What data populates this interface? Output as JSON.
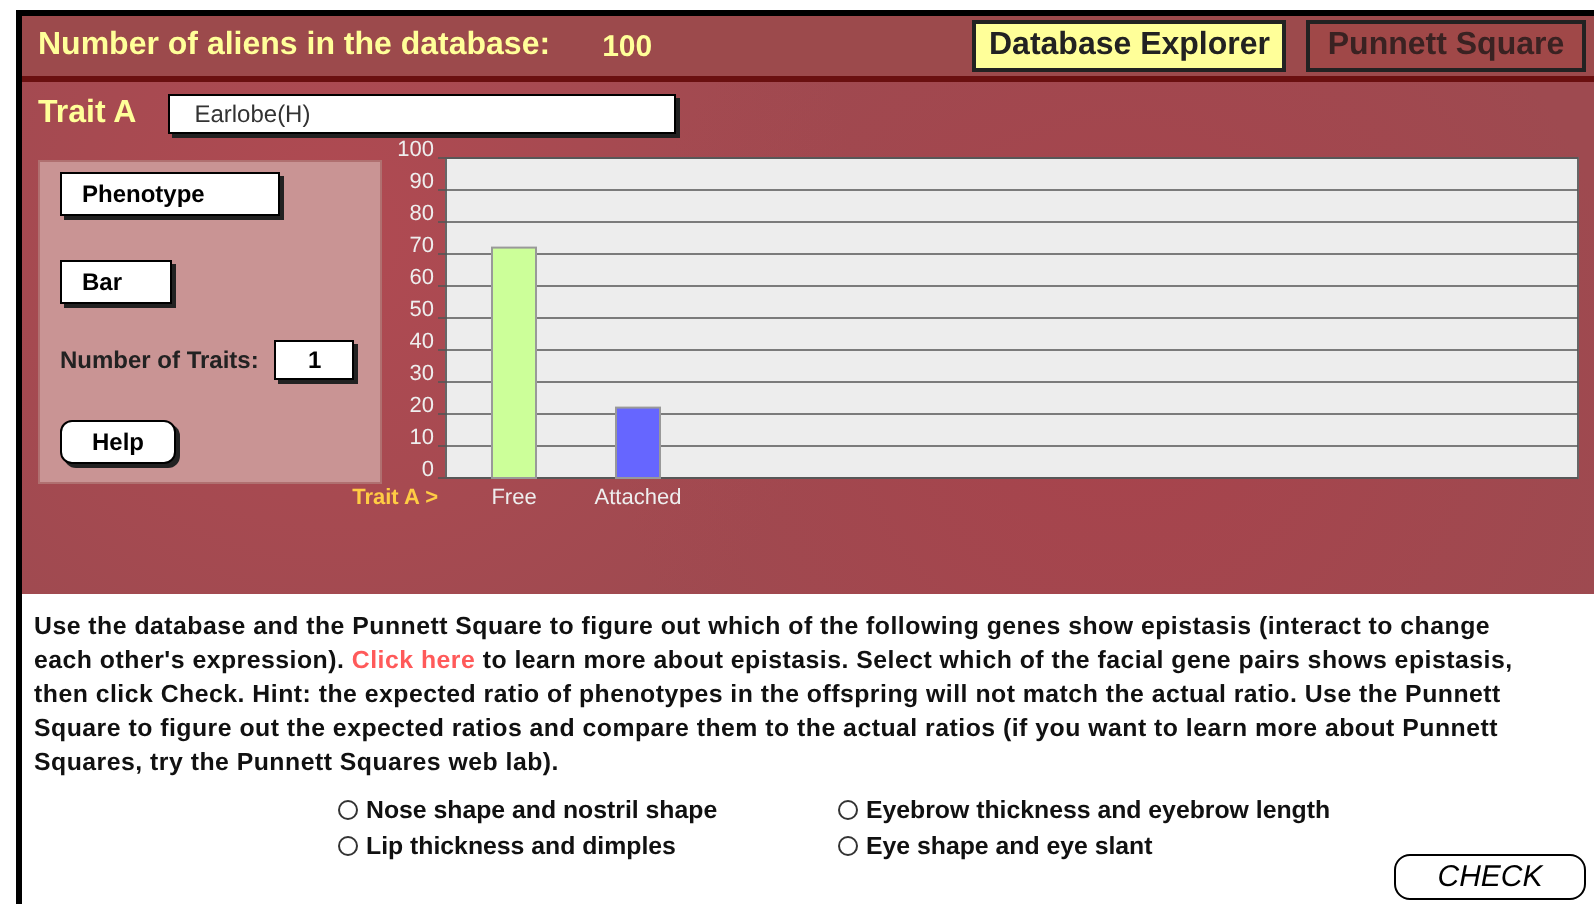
{
  "header": {
    "title": "Number of aliens in the database:",
    "count": "100"
  },
  "tabs": [
    {
      "label": "Database Explorer",
      "selected": true
    },
    {
      "label": "Punnett Square",
      "selected": false
    }
  ],
  "trait": {
    "label": "Trait A",
    "value": "Earlobe(H)"
  },
  "controls": {
    "phenotype_button": "Phenotype",
    "bar_button": "Bar",
    "traits_label": "Number of Traits:",
    "traits_value": "1",
    "help_button": "Help"
  },
  "chart_data": {
    "type": "bar",
    "xlabel": "Trait A >",
    "categories": [
      "Free",
      "Attached"
    ],
    "series": [
      {
        "color": "#ccff99",
        "values": [
          72,
          null
        ]
      },
      {
        "color": "#6666ff",
        "values": [
          null,
          22
        ]
      }
    ],
    "ylim": [
      0,
      100
    ],
    "yticks": [
      0,
      10,
      20,
      30,
      40,
      50,
      60,
      70,
      80,
      90,
      100
    ],
    "grid": true
  },
  "instructions": {
    "before": "Use the database and the Punnett Square to figure out which of the following genes show epistasis (interact to change each other's expression). ",
    "link": "Click here",
    "after": " to learn more about epistasis. Select which of the facial gene pairs shows epistasis, then click Check. Hint: the expected ratio of phenotypes in the offspring will not match the actual ratio. Use the Punnett Square to figure out the expected ratios and compare them to the actual ratios (if you want to learn more about Punnett Squares, try the Punnett Squares web lab)."
  },
  "options": [
    {
      "label": "Nose shape and nostril shape",
      "selected": false
    },
    {
      "label": "Eyebrow thickness and eyebrow length",
      "selected": false
    },
    {
      "label": "Lip thickness  and dimples",
      "selected": false
    },
    {
      "label": "Eye shape and eye slant",
      "selected": false
    }
  ],
  "check_button": "CHECK"
}
